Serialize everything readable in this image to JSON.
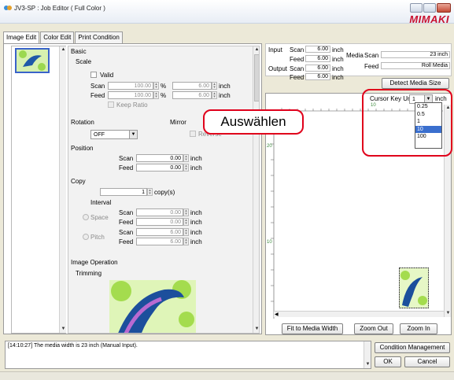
{
  "window": {
    "title": "JV3-SP : Job Editor ( Full Color )",
    "brand": "MIMAKI"
  },
  "tabs": [
    "Image Edit",
    "Color Edit",
    "Print Condition"
  ],
  "settings": {
    "basic_header": "Basic",
    "scale_label": "Scale",
    "valid_label": "Valid",
    "scan_label": "Scan",
    "feed_label": "Feed",
    "scale_scan_pct": "100.00",
    "scale_feed_pct": "100.00",
    "pct_unit": "%",
    "scale_scan_inch": "6.00",
    "scale_feed_inch": "6.00",
    "inch_unit": "inch",
    "keep_ratio_label": "Keep Ratio",
    "rotation_label": "Rotation",
    "rotation_value": "OFF",
    "mirror_label": "Mirror",
    "reverse_label": "Reverse",
    "position_label": "Position",
    "pos_scan": "0.00",
    "pos_feed": "0.00",
    "copy_label": "Copy",
    "copy_count": "1",
    "copy_unit": "copy(s)",
    "interval_label": "Interval",
    "space_label": "Space",
    "pitch_label": "Pitch",
    "space_scan": "0.00",
    "space_feed": "0.00",
    "pitch_scan": "6.00",
    "pitch_feed": "6.00",
    "image_operation_label": "Image Operation",
    "trimming_label": "Trimming"
  },
  "info": {
    "input_label": "Input",
    "output_label": "Output",
    "scan_label": "Scan",
    "feed_label": "Feed",
    "input_scan": "6.00",
    "input_feed": "6.00",
    "output_scan": "6.00",
    "output_feed": "6.00",
    "unit": "inch",
    "media_label": "Media",
    "media_scan_label": "Scan",
    "media_feed_label": "Feed",
    "media_scan_value": "23 inch",
    "media_feed_value": "Roll Media",
    "detect_button": "Detect Media Size"
  },
  "cursor_key": {
    "label": "Cursor Key Unit",
    "value": "1",
    "unit": "inch",
    "options": [
      "0.25",
      "0.5",
      "1",
      "10",
      "100"
    ],
    "highlighted": "10"
  },
  "ruler": {
    "top_labels": [
      "10",
      "20"
    ],
    "left_labels": [
      "20",
      "10"
    ]
  },
  "callout_text": "Auswählen",
  "preview_buttons": {
    "fit": "Fit to Media Width",
    "zoom_out": "Zoom Out",
    "zoom_in": "Zoom In"
  },
  "log_text": "[14:10:27] The media width is 23 inch (Manual Input).",
  "footer_buttons": {
    "condition": "Condition Management",
    "ok": "OK",
    "cancel": "Cancel"
  },
  "colors": {
    "accent_red": "#e0001b",
    "selection_blue": "#3a6fce",
    "brand_red": "#c8102e"
  }
}
